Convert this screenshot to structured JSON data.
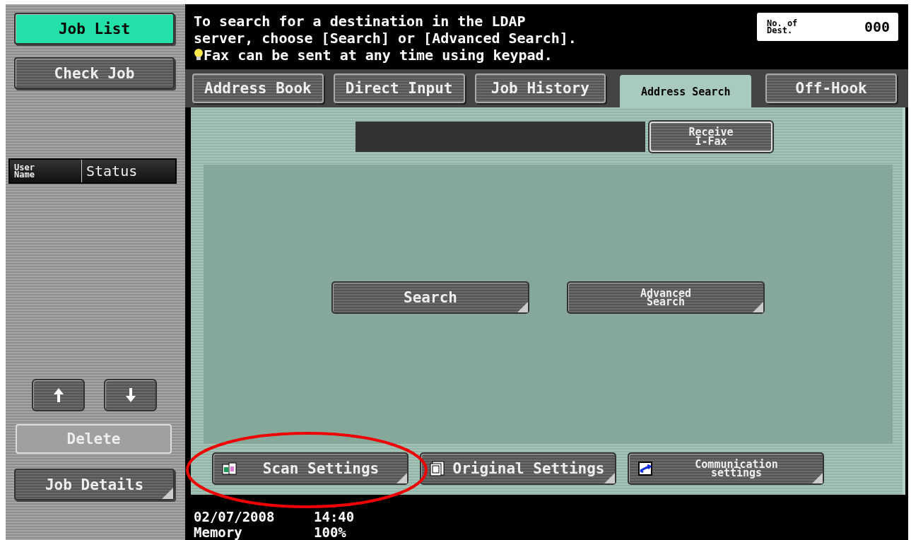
{
  "sidebar": {
    "buttons": [
      {
        "label": "Job List",
        "selected": true
      },
      {
        "label": "Check Job",
        "selected": false
      }
    ],
    "job_table": {
      "columns": [
        "User\nName",
        "Status"
      ]
    },
    "scroll_buttons": [
      {
        "kind": "up"
      },
      {
        "kind": "down"
      }
    ],
    "actions": [
      {
        "label": "Delete",
        "disabled": true,
        "submenu": false
      },
      {
        "label": "Job Details",
        "disabled": false,
        "submenu": true
      }
    ]
  },
  "message": {
    "lines": [
      "To search for a destination in the LDAP",
      "server, choose [Search] or [Advanced Search].",
      "Fax can be sent at any time using keypad."
    ]
  },
  "destinations": {
    "label": "No. of\nDest.",
    "value": "000"
  },
  "tabs": [
    {
      "label": "Address Book",
      "selected": false
    },
    {
      "label": "Direct Input",
      "selected": false
    },
    {
      "label": "Job History",
      "selected": false
    },
    {
      "label": "Address Search",
      "selected": true
    },
    {
      "label": "Off-Hook",
      "selected": false
    }
  ],
  "receive_button": {
    "label": "Receive\nI-Fax"
  },
  "search_buttons": [
    {
      "label": "Search"
    },
    {
      "label": "Advanced\nSearch"
    }
  ],
  "bottom_buttons": [
    {
      "label": "Scan Settings",
      "kind": "scan"
    },
    {
      "label": "Original Settings",
      "kind": "original"
    },
    {
      "label": "Communication\nsettings",
      "kind": "communication"
    }
  ],
  "footer": {
    "date": "02/07/2008",
    "time": "14:40",
    "memory_label": "Memory",
    "memory_value": "100%"
  }
}
